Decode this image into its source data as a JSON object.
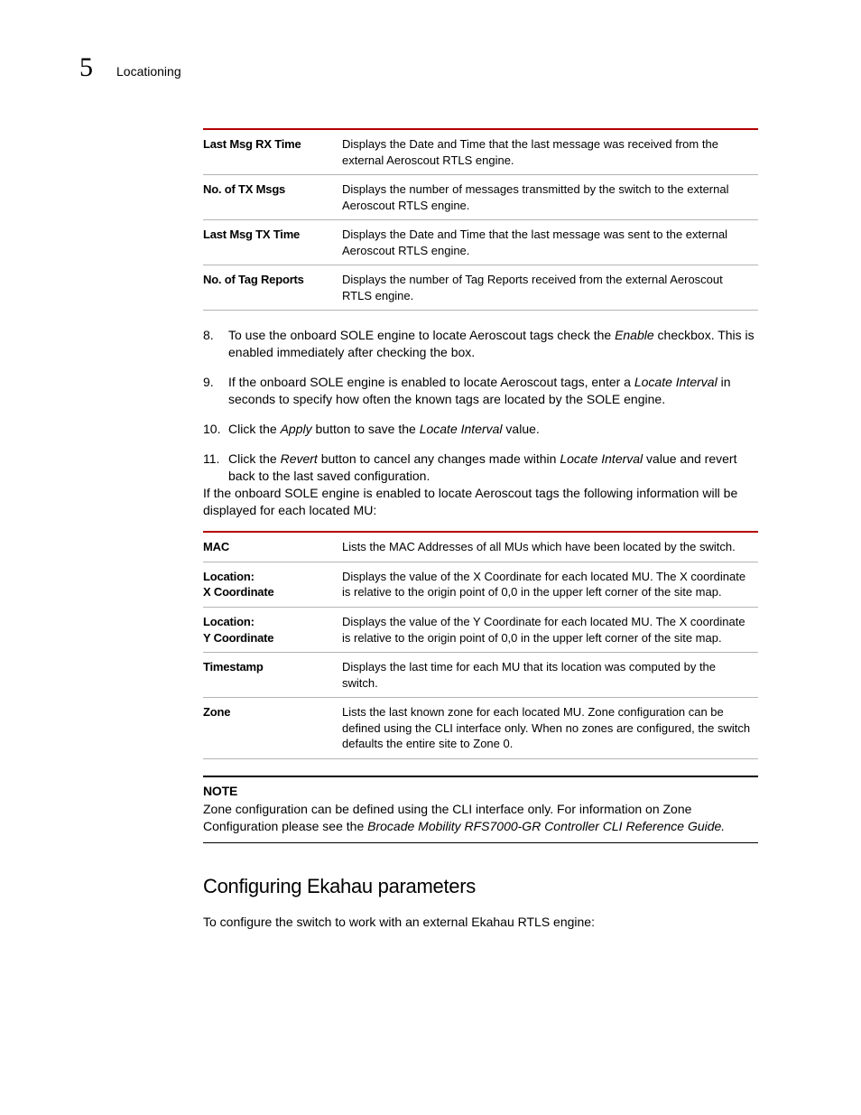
{
  "header": {
    "chapter_number": "5",
    "section_title": "Locationing"
  },
  "table1": {
    "rows": [
      {
        "term": "Last Msg RX Time",
        "desc": "Displays the Date and Time that the last message was received from the external Aeroscout RTLS engine."
      },
      {
        "term": "No. of TX Msgs",
        "desc": "Displays the number of messages transmitted by the switch to the external Aeroscout RTLS engine."
      },
      {
        "term": "Last Msg TX Time",
        "desc": "Displays the Date and Time that the last message was sent to the external Aeroscout RTLS engine."
      },
      {
        "term": "No. of Tag Reports",
        "desc": "Displays the number of Tag Reports received from the external Aeroscout RTLS engine."
      }
    ]
  },
  "steps": [
    {
      "num": "8.",
      "pre": "To use the onboard SOLE engine to locate Aeroscout tags check the ",
      "em1": "Enable",
      "post1": " checkbox. This is enabled immediately after checking the box."
    },
    {
      "num": "9.",
      "pre": "If the onboard SOLE engine is enabled to locate Aeroscout tags, enter a ",
      "em1": "Locate Interval",
      "post1": " in seconds to specify how often the known tags are located by the SOLE engine."
    },
    {
      "num": "10.",
      "pre": "Click the ",
      "em1": "Apply",
      "mid1": " button to save the ",
      "em2": "Locate Interval",
      "post2": " value."
    },
    {
      "num": "11.",
      "pre": "Click the ",
      "em1": "Revert",
      "mid1": " button to cancel any changes made within ",
      "em2": "Locate Interval",
      "post2": " value and revert back to the last saved configuration."
    }
  ],
  "para_intro2": "If the onboard SOLE engine is enabled to locate Aeroscout tags the following information will be displayed for each located MU:",
  "table2": {
    "rows": [
      {
        "term": "MAC",
        "desc": "Lists the MAC Addresses of all MUs which have been located by the switch."
      },
      {
        "term": "Location:\nX Coordinate",
        "desc": "Displays the value of the X Coordinate for each located MU. The X coordinate is relative to the origin point of 0,0 in the upper left corner of the site map."
      },
      {
        "term": "Location:\nY Coordinate",
        "desc": "Displays the value of the Y Coordinate for each located MU. The X coordinate is relative to the origin point of 0,0 in the upper left corner of the site map."
      },
      {
        "term": "Timestamp",
        "desc": "Displays the last time for each MU that its location was computed by the switch."
      },
      {
        "term": "Zone",
        "desc": "Lists the last known zone for each located MU. Zone configuration can be defined using the CLI interface only. When no zones are configured, the switch defaults the entire site to Zone 0."
      }
    ]
  },
  "note": {
    "label": "NOTE",
    "text_pre": "Zone configuration can be defined using the CLI interface only. For information on Zone Configuration please see the ",
    "text_em": "Brocade Mobility RFS7000-GR Controller CLI Reference Guide."
  },
  "subhead": "Configuring Ekahau parameters",
  "para_sub": "To configure the switch to work with an external Ekahau RTLS engine:"
}
